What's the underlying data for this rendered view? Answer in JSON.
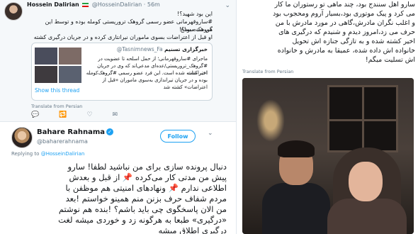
{
  "tweet1": {
    "author_name": "Hossein Dalirian",
    "author_handle": "@HosseinDalirian · 56m",
    "lines": [
      "این بود شهید؟!",
      "#ساروقهرمانی عضو رسمی گروهک تروریستی کومله بوده و توسط این گروهک مسلح",
      "هم شده بود؟!",
      "او قبل از اعتراضات بسوی ماموران نیرانتاری کرده و در جریان درگیری کشته شده"
    ],
    "quote": {
      "name": "خبرگزاری تسنیم",
      "handle": "@Tasnimnews_Fa",
      "lines": [
        "ماجرای #ساروقهرمانی؛ از حمل اسلحه تا عضویت در",
        "#گروهک_تروریستی/عده‌ای مدعی‌اند که وی در جریان اعتراضات",
        "اخیر کشته شده است. این فرد عضو رسمی #گروهک‌کومله",
        "بوده و در جریان تیراندازی به‌سوی ماموران «قبل از",
        "اعتراضات» کشته شد"
      ],
      "show_thread": "Show this thread"
    },
    "translate": "Translate from Persian",
    "actions": {
      "reply": "💬",
      "retweet": "🔁",
      "like": "♡",
      "dm": "✉"
    }
  },
  "tweet2": {
    "author_name": "Bahare Rahnama",
    "verified": "✓",
    "author_handle": "@baharerahnama",
    "follow_label": "Follow",
    "replying_prefix": "Replying to",
    "replying_handle": "@HosseinDalirian",
    "lines": [
      "دنبال پرونده سازی برای من نباشید لطفا! سارو",
      "پیش من مدتی کار می‌کرده 📌 از قبل و بعدش",
      "اطلاعی ندارم 📌 ونهادهای امنیتی هم موظفن با",
      "مردم شفاف حرف بزنن منم همینو خواستم !بعد",
      "من الان پاسخگوی چی باید باشم؟ !بنده هم نوشتم",
      "«درگیری» طبعا به هرگونه زد و خوردی میشه لغت",
      "درگیری اطلاق میشه"
    ]
  },
  "tweet3": {
    "lines": [
      "سارو اهل سنندج بود، چند ماهی تو رستوران ما کار",
      "می کرد و پیک موتوری بود،بسیار آروم ومحجوب بود",
      "و اغلب نگران مادرش،گاهی در مورد مادرش با من",
      "حرف می زد،امروز دیدم و شنیدم که درگیری های",
      "اخیر کشته شده و به تازگی جنازه اش تحویل",
      "خانواده اش داده شده، عمیقا به مادرش و خانواده",
      "اش تسلیت میگم!"
    ],
    "translate": "Translate from Persian"
  },
  "colors": {
    "twitter_blue": "#1da1f2",
    "muted_text": "#657786",
    "background": "#ffffff"
  }
}
